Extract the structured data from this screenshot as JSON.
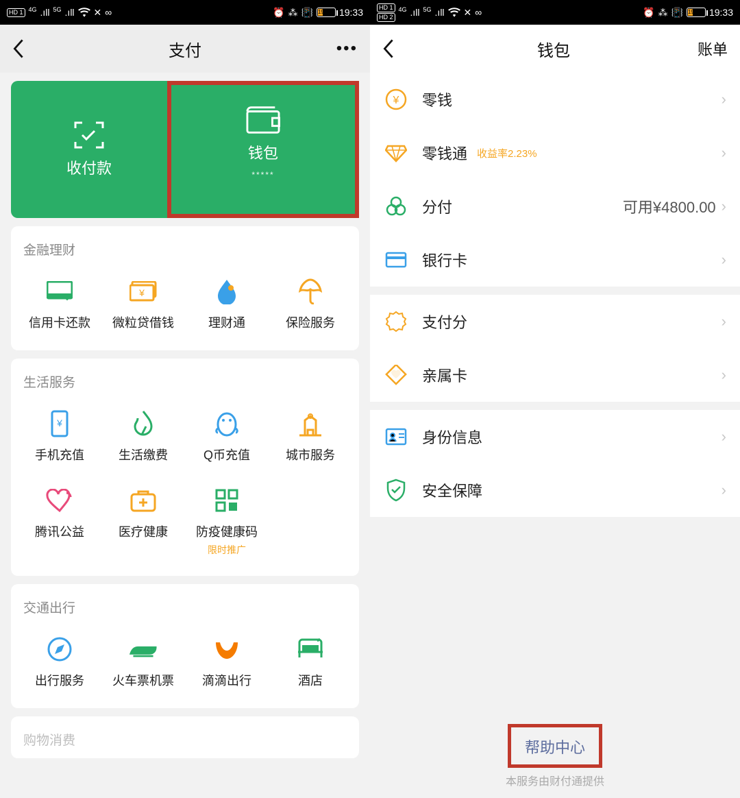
{
  "status": {
    "time": "19:33",
    "battery_text": "19"
  },
  "left": {
    "title": "支付",
    "hero": {
      "pay_label": "收付款",
      "wallet_label": "钱包",
      "wallet_mask": "*****"
    },
    "sections": [
      {
        "title": "金融理财",
        "items": [
          {
            "label": "信用卡还款"
          },
          {
            "label": "微粒贷借钱"
          },
          {
            "label": "理财通"
          },
          {
            "label": "保险服务"
          }
        ]
      },
      {
        "title": "生活服务",
        "items": [
          {
            "label": "手机充值"
          },
          {
            "label": "生活缴费"
          },
          {
            "label": "Q币充值"
          },
          {
            "label": "城市服务"
          },
          {
            "label": "腾讯公益"
          },
          {
            "label": "医疗健康"
          },
          {
            "label": "防疫健康码",
            "sub": "限时推广"
          }
        ]
      },
      {
        "title": "交通出行",
        "items": [
          {
            "label": "出行服务"
          },
          {
            "label": "火车票机票"
          },
          {
            "label": "滴滴出行"
          },
          {
            "label": "酒店"
          }
        ]
      },
      {
        "title": "购物消费",
        "items": []
      }
    ]
  },
  "right": {
    "title": "钱包",
    "right_link": "账单",
    "items": [
      {
        "label": "零钱",
        "value": ""
      },
      {
        "label": "零钱通",
        "tag": "收益率2.23%",
        "value": ""
      },
      {
        "label": "分付",
        "value": "可用¥4800.00"
      },
      {
        "label": "银行卡"
      },
      {
        "gap": true
      },
      {
        "label": "支付分"
      },
      {
        "label": "亲属卡"
      },
      {
        "gap": true
      },
      {
        "label": "身份信息"
      },
      {
        "label": "安全保障"
      }
    ],
    "help": "帮助中心",
    "provider": "本服务由财付通提供"
  }
}
